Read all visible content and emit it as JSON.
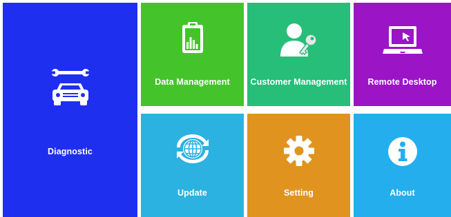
{
  "tiles": {
    "diagnostic": {
      "label": "Diagnostic",
      "icon": "car-wrench-icon",
      "color": "#1f2ff0"
    },
    "data_management": {
      "label": "Data Management",
      "icon": "clipboard-chart-icon",
      "color": "#44c42a"
    },
    "customer_management": {
      "label": "Customer Management",
      "icon": "user-key-icon",
      "color": "#26be78"
    },
    "remote_desktop": {
      "label": "Remote Desktop",
      "icon": "laptop-cursor-icon",
      "color": "#9b14c6"
    },
    "update": {
      "label": "Update",
      "icon": "globe-refresh-icon",
      "color": "#2bb2e0"
    },
    "setting": {
      "label": "Setting",
      "icon": "gear-icon",
      "color": "#e0941f"
    },
    "about": {
      "label": "About",
      "icon": "info-icon",
      "color": "#24aeee"
    }
  }
}
